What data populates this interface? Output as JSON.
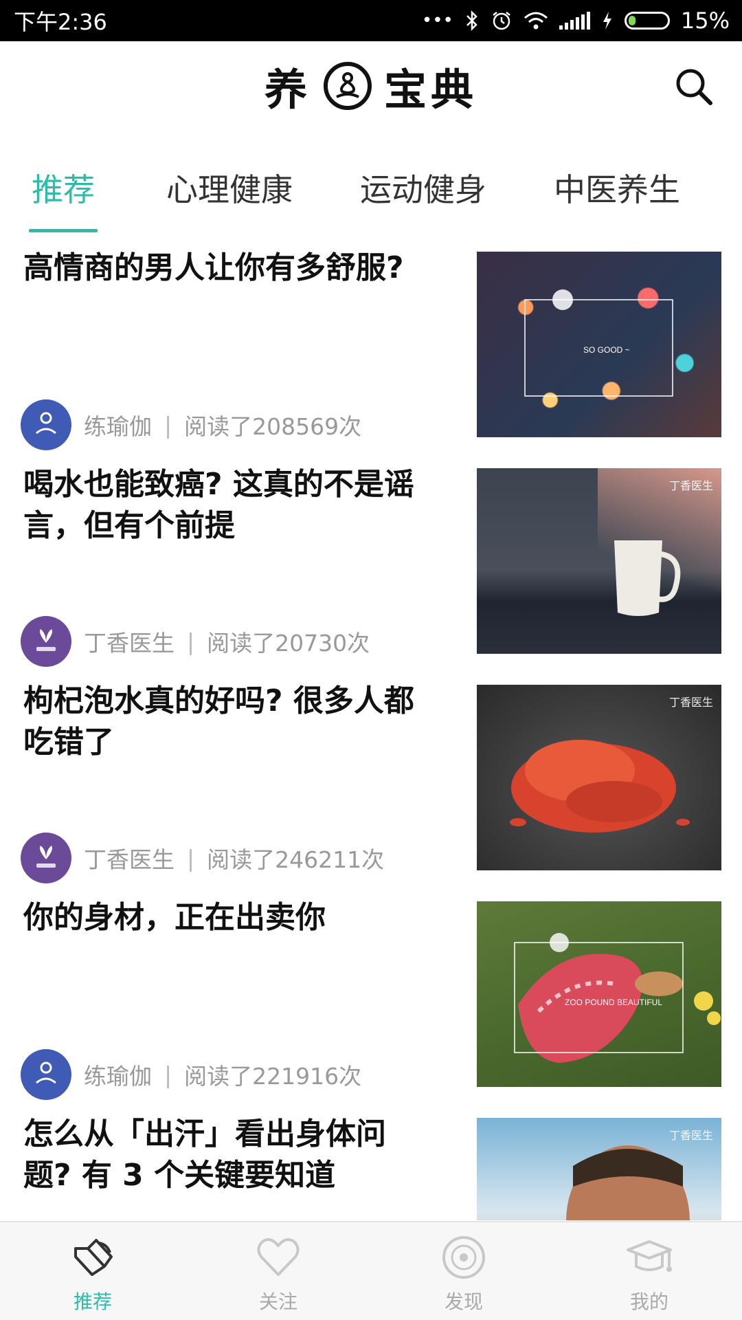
{
  "status_bar": {
    "time": "下午2:36",
    "dots": "•••",
    "battery": "15%"
  },
  "header": {
    "logo_left": "养",
    "logo_right": "宝典"
  },
  "tabs": [
    {
      "label": "推荐",
      "active": true
    },
    {
      "label": "心理健康",
      "active": false
    },
    {
      "label": "运动健身",
      "active": false
    },
    {
      "label": "中医养生",
      "active": false
    }
  ],
  "articles": [
    {
      "title": "高情商的男人让你有多舒服?",
      "source": "练瑜伽",
      "reads": "阅读了208569次",
      "thumb_text": "SO GOOD ~"
    },
    {
      "title": "喝水也能致癌? 这真的不是谣言，但有个前提",
      "source": "丁香医生",
      "reads": "阅读了20730次",
      "thumb_text": "丁香医生"
    },
    {
      "title": "枸杞泡水真的好吗? 很多人都吃错了",
      "source": "丁香医生",
      "reads": "阅读了246211次",
      "thumb_text": "丁香医生"
    },
    {
      "title": "你的身材，正在出卖你",
      "source": "练瑜伽",
      "reads": "阅读了221916次",
      "thumb_text": "ZOO POUND BEAUTIFUL"
    },
    {
      "title": "怎么从「出汗」看出身体问题? 有 3 个关键要知道",
      "thumb_text": "丁香医生"
    }
  ],
  "separator": "|",
  "bottom_nav": [
    {
      "label": "推荐",
      "icon": "speaker-icon",
      "active": true
    },
    {
      "label": "关注",
      "icon": "heart-icon",
      "active": false
    },
    {
      "label": "发现",
      "icon": "disc-icon",
      "active": false
    },
    {
      "label": "我的",
      "icon": "graduation-cap-icon",
      "active": false
    }
  ],
  "colors": {
    "accent": "#2bbcaa",
    "status_bar": "#000000",
    "meta_text": "#999999"
  }
}
